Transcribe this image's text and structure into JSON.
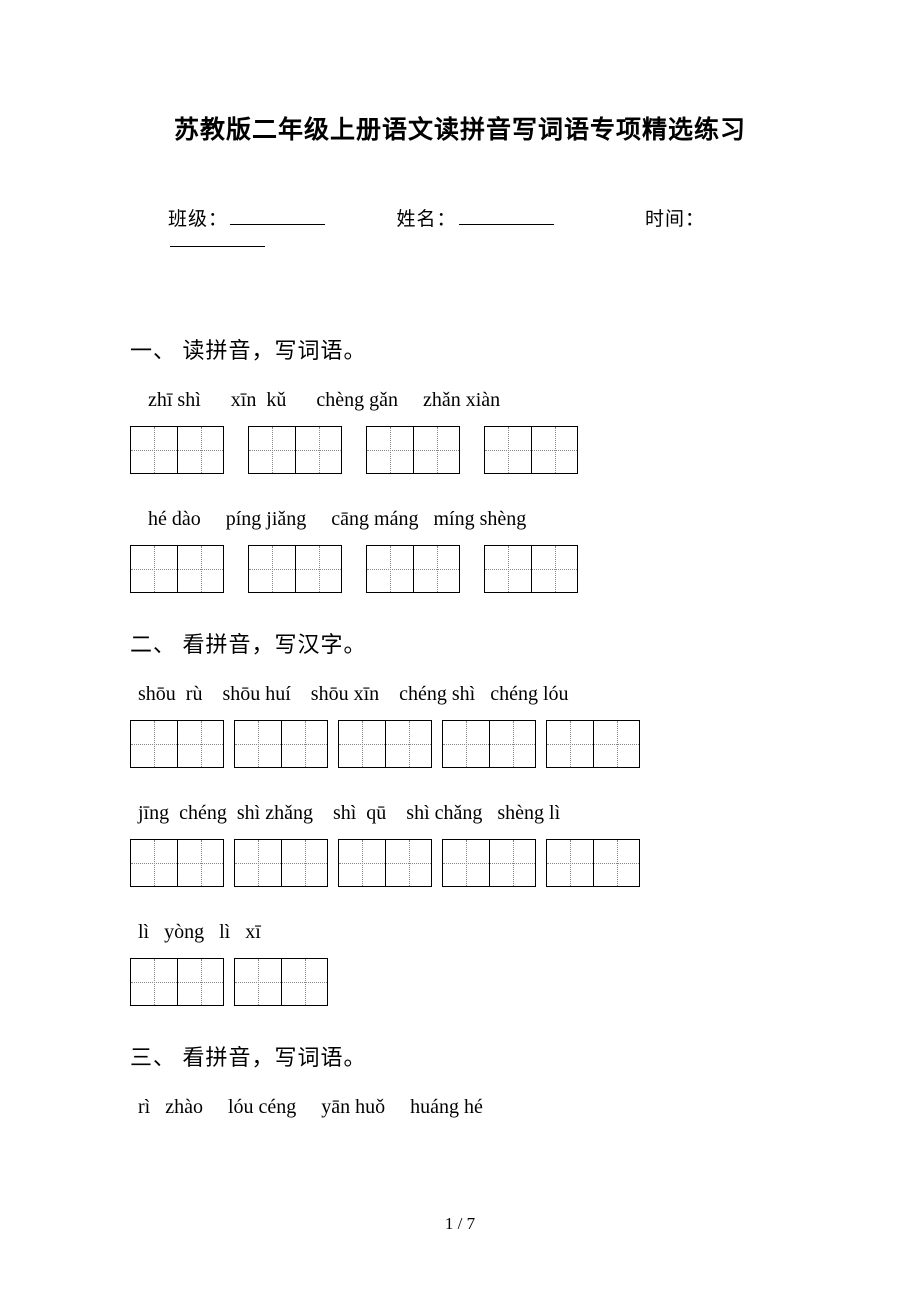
{
  "title": "苏教版二年级上册语文读拼音写词语专项精选练习",
  "info": {
    "class_label": "班级：",
    "name_label": "姓名：",
    "time_label": "时间："
  },
  "sections": [
    {
      "heading": "一、 读拼音，写词语。",
      "rows": [
        {
          "pinyin": "  zhī shì      xīn  kǔ      chèng gǎn     zhǎn xiàn",
          "groups": 4,
          "tight": false
        },
        {
          "pinyin": "  hé dào     píng jiǎng     cāng máng   míng shèng",
          "groups": 4,
          "tight": false
        }
      ]
    },
    {
      "heading": "二、 看拼音，写汉字。",
      "rows": [
        {
          "pinyin": "shōu  rù    shōu huí    shōu xīn    chéng shì   chéng lóu",
          "groups": 5,
          "tight": true
        },
        {
          "pinyin": "jīng  chéng  shì zhǎng    shì  qū    shì chǎng   shèng lì",
          "groups": 5,
          "tight": true
        },
        {
          "pinyin": "lì   yòng   lì   xī",
          "groups": 2,
          "tight": true
        }
      ]
    },
    {
      "heading": "三、 看拼音，写词语。",
      "rows": [
        {
          "pinyin": "rì   zhào     lóu céng     yān huǒ     huáng hé",
          "groups": 0,
          "tight": false
        }
      ]
    }
  ],
  "footer": "1 / 7"
}
